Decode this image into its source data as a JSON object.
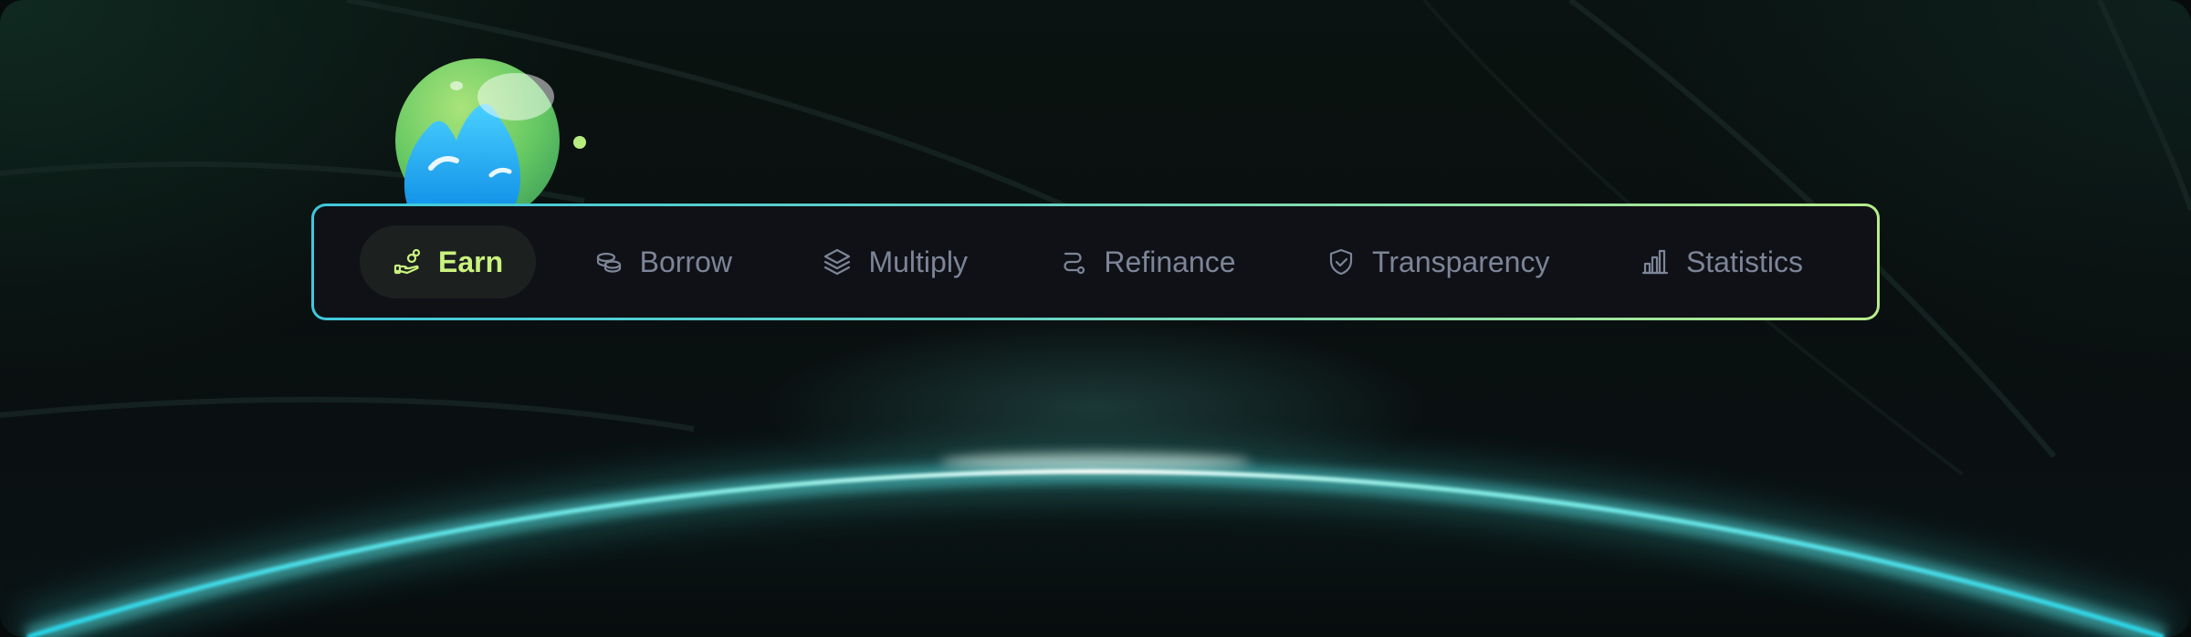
{
  "nav": {
    "items": [
      {
        "label": "Earn",
        "icon": "hand-coins-icon",
        "active": true
      },
      {
        "label": "Borrow",
        "icon": "coins-stack-icon",
        "active": false
      },
      {
        "label": "Multiply",
        "icon": "layers-icon",
        "active": false
      },
      {
        "label": "Refinance",
        "icon": "route-icon",
        "active": false
      },
      {
        "label": "Transparency",
        "icon": "shield-check-icon",
        "active": false
      },
      {
        "label": "Statistics",
        "icon": "bar-chart-icon",
        "active": false
      }
    ]
  },
  "colors": {
    "active_text": "#c9f27f",
    "inactive_text": "#7c8598",
    "border_start": "#3ec8dc",
    "border_end": "#b6ec8a",
    "bar_background": "#101116",
    "glow": "#4fe3ee"
  },
  "mascot": {
    "icon": "water-drop-mascot-icon"
  }
}
